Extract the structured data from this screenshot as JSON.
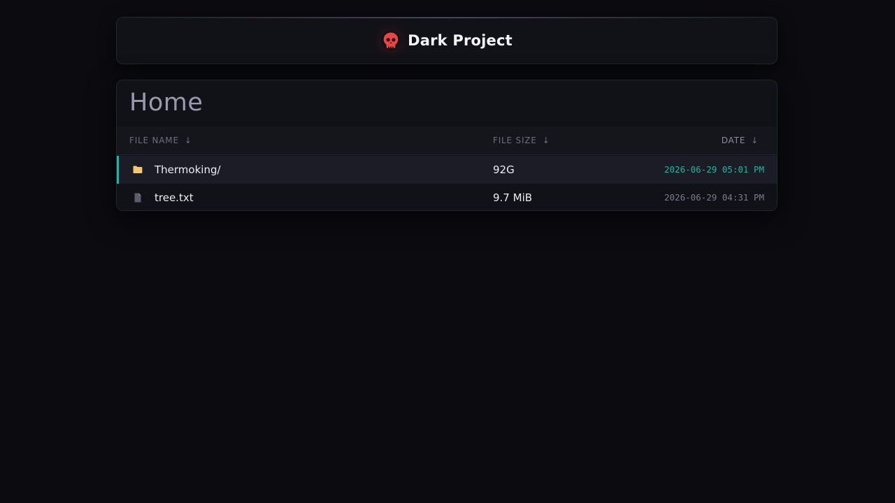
{
  "header": {
    "title": "Dark Project",
    "logo_icon": "skull-icon",
    "logo_color": "#ef4444",
    "accent_color": "#14b8a6"
  },
  "listing": {
    "title": "Home",
    "columns": {
      "name": "FILE NAME",
      "size": "FILE SIZE",
      "date": "DATE",
      "sort_arrow": "↓"
    },
    "rows": [
      {
        "type": "folder",
        "icon": "folder-icon",
        "name": "Thermoking/",
        "size": "92G",
        "date": "2026-06-29 05:01 PM",
        "highlighted": true
      },
      {
        "type": "file",
        "icon": "file-icon",
        "name": "tree.txt",
        "size": "9.7 MiB",
        "date": "2026-06-29 04:31 PM",
        "highlighted": false
      }
    ]
  }
}
